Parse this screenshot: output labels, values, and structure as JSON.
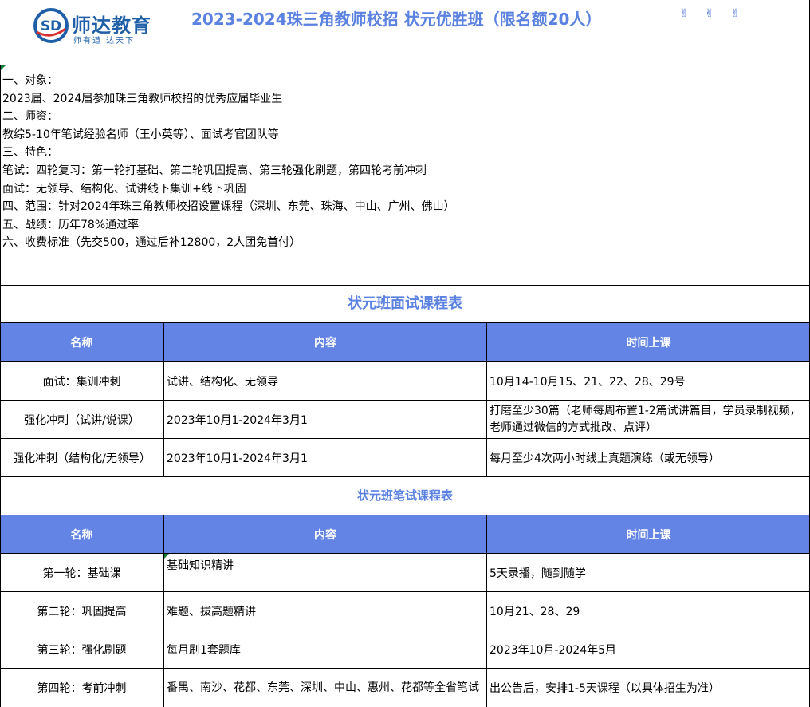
{
  "header": {
    "logo_mark": "SD",
    "logo_name": "师达教育",
    "logo_slogan": "师有道  达天下",
    "title": "2023-2024珠三角教师校招 状元优胜班（限名额20人）",
    "deco_icons": [
      "victory-hand-icon",
      "victory-hand-icon",
      "victory-hand-icon"
    ],
    "deco_glyph": "✌",
    "brand_color": "#1f5fa8",
    "title_color": "#5b82e0"
  },
  "intro": {
    "lines": [
      "一、对象：",
      "2023届、2024届参加珠三角教师校招的优秀应届毕业生",
      "二、师资：",
      "教综5-10年笔试经验名师（王小英等）、面试考官团队等",
      "三、特色：",
      "笔试：四轮复习：第一轮打基础、第二轮巩固提高、第三轮强化刷题，第四轮考前冲刺",
      "面试：无领导、结构化、试讲线下集训+线下巩固",
      "四、范围：针对2024年珠三角教师校招设置课程（深圳、东莞、珠海、中山、广州、佛山）",
      "五、战绩：历年78%通过率",
      "六、收费标准（先交500，通过后补12800，2人团免首付）"
    ]
  },
  "interview_table": {
    "title": "状元班面试课程表",
    "headers": [
      "名称",
      "内容",
      "时间上课"
    ],
    "rows": [
      [
        "面试：集训冲刺",
        "试讲、结构化、无领导",
        "10月14-10月15、21、22、28、29号"
      ],
      [
        "强化冲刺（试讲/说课）",
        "2023年10月1-2024年3月1",
        "打磨至少30篇（老师每周布置1-2篇试讲篇目，学员录制视频，老师通过微信的方式批改、点评）"
      ],
      [
        "强化冲刺（结构化/无领导）",
        "2023年10月1-2024年3月1",
        "每月至少4次两小时线上真题演练（或无领导）"
      ]
    ]
  },
  "written_table": {
    "title": "状元班笔试课程表",
    "headers": [
      "名称",
      "内容",
      "时间上课"
    ],
    "rows": [
      [
        "第一轮：基础课",
        "基础知识精讲",
        "5天录播，随到随学"
      ],
      [
        "第二轮：巩固提高",
        "难题、拔高题精讲",
        "10月21、28、29"
      ],
      [
        "第三轮：强化刷题",
        "每月刷1套题库",
        "2023年10月-2024年5月"
      ],
      [
        "第四轮：考前冲刺",
        "番禺、南沙、花都、东莞、深圳、中山、惠州、花都等全省笔试",
        "出公告后，安排1-5天课程（以具体招生为准）"
      ]
    ]
  },
  "colors": {
    "header_fill": "#6384e4",
    "header_text": "#ffffff",
    "section_title": "#5b82e0"
  }
}
